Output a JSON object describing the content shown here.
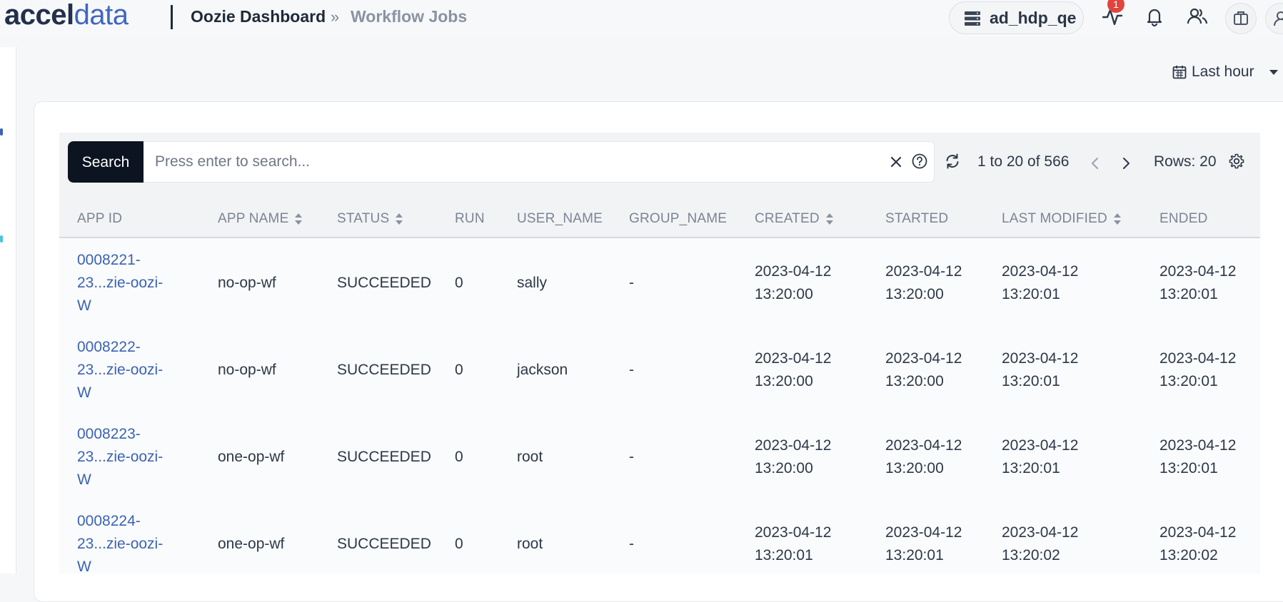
{
  "header": {
    "logo_dark": "accel",
    "logo_light": "data",
    "breadcrumb": {
      "parent": "Oozie Dashboard",
      "separator": "»",
      "current": "Workflow Jobs"
    },
    "cluster": "ad_hdp_qe",
    "notifications_count": "1",
    "icons": [
      "server-icon",
      "activity-icon",
      "bell-icon",
      "users-icon",
      "briefcase-icon",
      "user-icon"
    ]
  },
  "time_range": {
    "label": "Last hour"
  },
  "toolbar": {
    "search_label": "Search",
    "search_placeholder": "Press enter to search...",
    "page_info": "1 to 20 of 566",
    "rows_label": "Rows: 20"
  },
  "table": {
    "columns": [
      "APP ID",
      "APP NAME",
      "STATUS",
      "RUN",
      "USER_NAME",
      "GROUP_NAME",
      "CREATED",
      "STARTED",
      "LAST MODIFIED",
      "ENDED"
    ],
    "sortable": [
      "APP NAME",
      "STATUS",
      "CREATED",
      "LAST MODIFIED"
    ],
    "rows": [
      {
        "app_id": [
          "0008221-",
          "23...zie-oozi-",
          "W"
        ],
        "app_name": "no-op-wf",
        "status": "SUCCEEDED",
        "run": "0",
        "user_name": "sally",
        "group_name": "-",
        "created": [
          "2023-04-12",
          "13:20:00"
        ],
        "started": [
          "2023-04-12",
          "13:20:00"
        ],
        "last_modified": [
          "2023-04-12",
          "13:20:01"
        ],
        "ended": [
          "2023-04-12",
          "13:20:01"
        ]
      },
      {
        "app_id": [
          "0008222-",
          "23...zie-oozi-",
          "W"
        ],
        "app_name": "no-op-wf",
        "status": "SUCCEEDED",
        "run": "0",
        "user_name": "jackson",
        "group_name": "-",
        "created": [
          "2023-04-12",
          "13:20:00"
        ],
        "started": [
          "2023-04-12",
          "13:20:00"
        ],
        "last_modified": [
          "2023-04-12",
          "13:20:01"
        ],
        "ended": [
          "2023-04-12",
          "13:20:01"
        ]
      },
      {
        "app_id": [
          "0008223-",
          "23...zie-oozi-",
          "W"
        ],
        "app_name": "one-op-wf",
        "status": "SUCCEEDED",
        "run": "0",
        "user_name": "root",
        "group_name": "-",
        "created": [
          "2023-04-12",
          "13:20:00"
        ],
        "started": [
          "2023-04-12",
          "13:20:00"
        ],
        "last_modified": [
          "2023-04-12",
          "13:20:01"
        ],
        "ended": [
          "2023-04-12",
          "13:20:01"
        ]
      },
      {
        "app_id": [
          "0008224-",
          "23...zie-oozi-",
          "W"
        ],
        "app_name": "one-op-wf",
        "status": "SUCCEEDED",
        "run": "0",
        "user_name": "root",
        "group_name": "-",
        "created": [
          "2023-04-12",
          "13:20:01"
        ],
        "started": [
          "2023-04-12",
          "13:20:01"
        ],
        "last_modified": [
          "2023-04-12",
          "13:20:02"
        ],
        "ended": [
          "2023-04-12",
          "13:20:02"
        ]
      }
    ]
  },
  "colors": {
    "accent": "#3f66c1",
    "link": "#3a63b5",
    "badge": "#e0453d",
    "search_button": "#0b1420"
  }
}
